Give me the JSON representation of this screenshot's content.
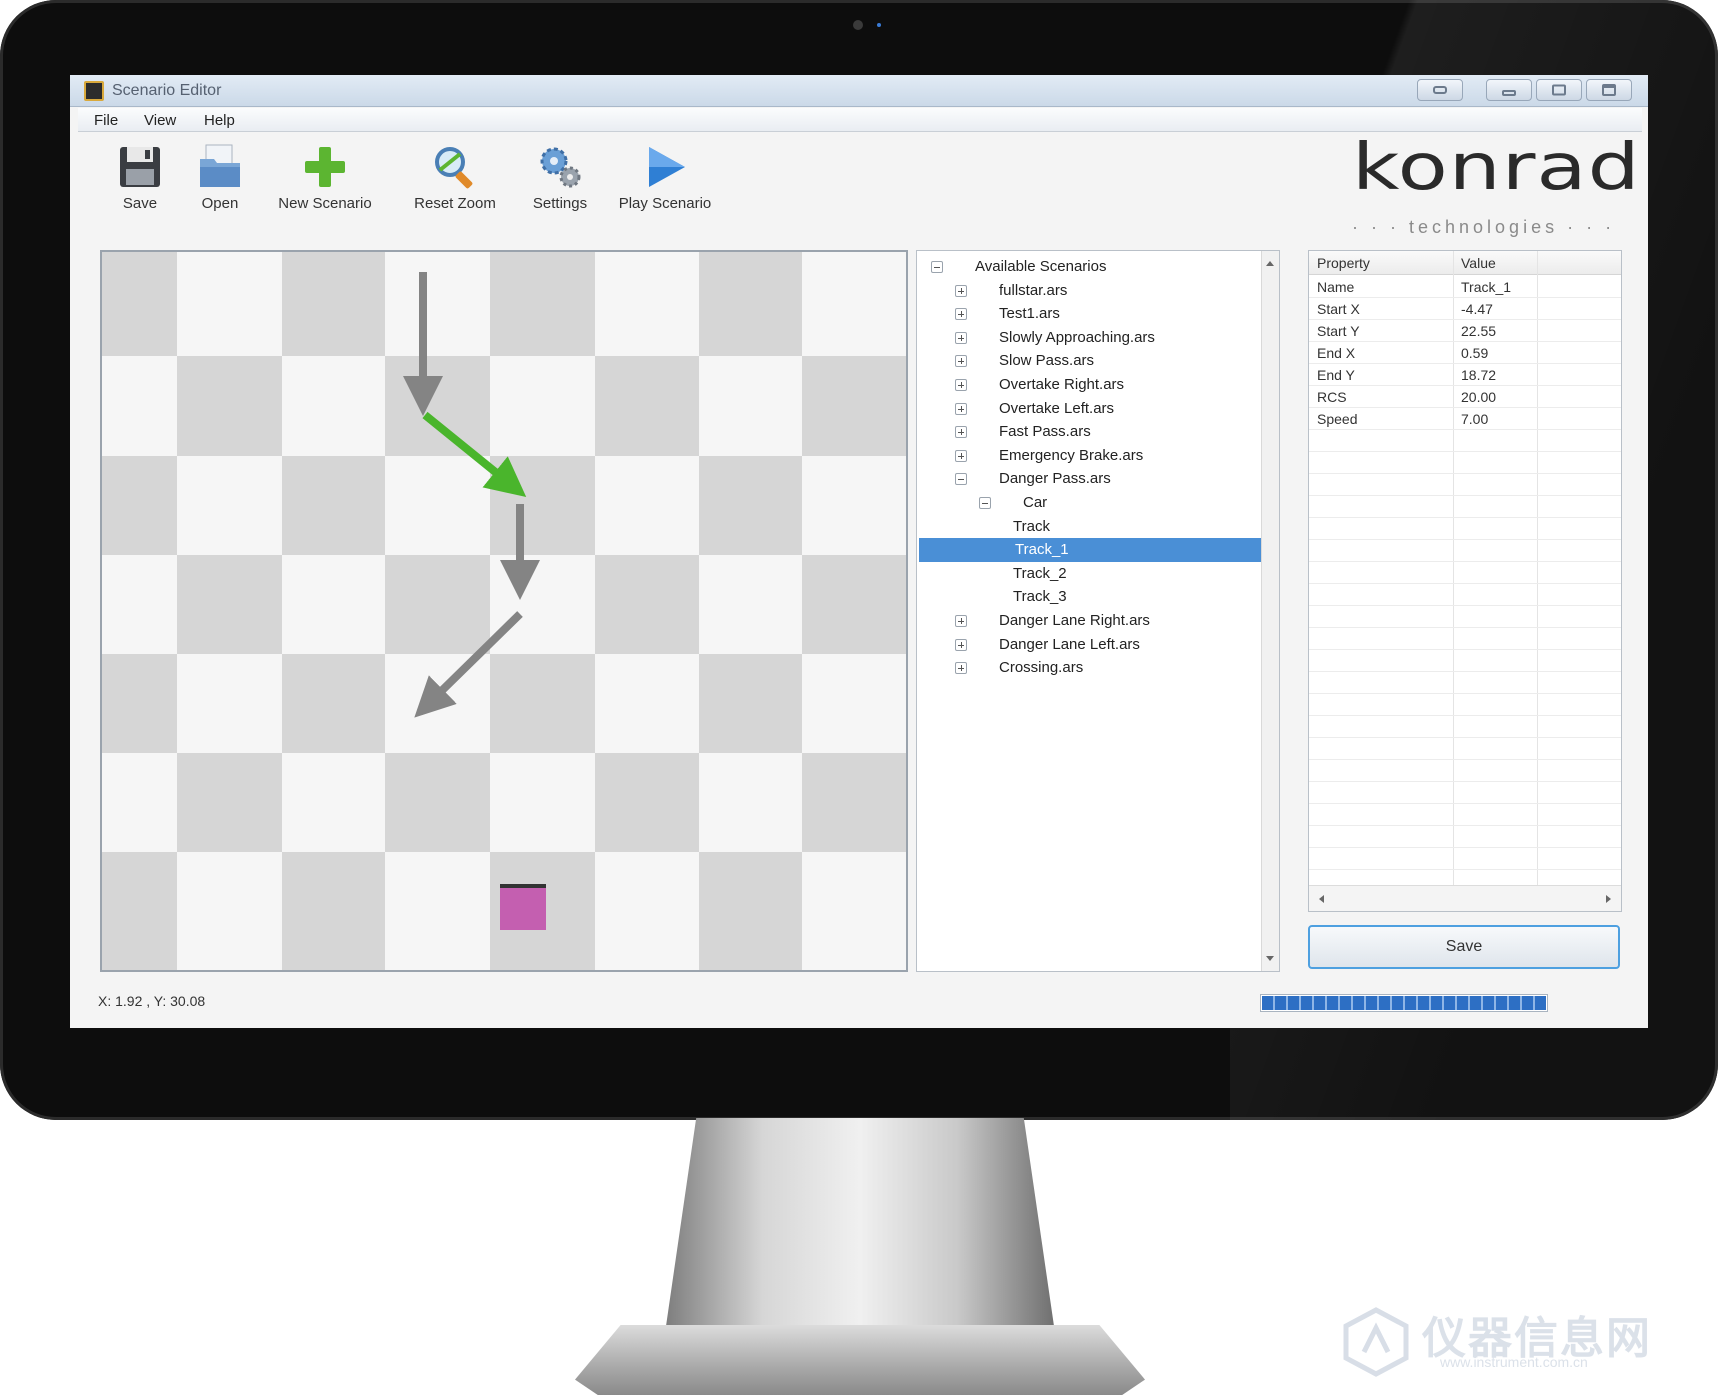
{
  "window": {
    "title": "Scenario Editor"
  },
  "menu": [
    "File",
    "View",
    "Help"
  ],
  "toolbar": [
    {
      "label": "Save",
      "icon": "floppy-disk-icon"
    },
    {
      "label": "Open",
      "icon": "open-folder-icon"
    },
    {
      "label": "New Scenario",
      "icon": "green-plus-icon"
    },
    {
      "label": "Reset Zoom",
      "icon": "magnifier-icon"
    },
    {
      "label": "Settings",
      "icon": "gears-icon"
    },
    {
      "label": "Play Scenario",
      "icon": "play-triangle-icon"
    }
  ],
  "logo": {
    "word": "konrad",
    "tagline": "technologies"
  },
  "canvas": {
    "grid_colors": {
      "light": "#f6f6f6",
      "dark": "#d6d6d6"
    },
    "track_colors": {
      "default": "#848484",
      "selected": "#4ab52c"
    },
    "object_color": "#c45fb0"
  },
  "tree": {
    "root": "Available Scenarios",
    "items": [
      {
        "label": "fullstar.ars"
      },
      {
        "label": "Test1.ars"
      },
      {
        "label": "Slowly Approaching.ars"
      },
      {
        "label": "Slow Pass.ars"
      },
      {
        "label": "Overtake Right.ars"
      },
      {
        "label": "Overtake Left.ars"
      },
      {
        "label": "Fast Pass.ars"
      },
      {
        "label": "Emergency Brake.ars"
      },
      {
        "label": "Danger Pass.ars"
      },
      {
        "label": "Car"
      },
      {
        "label": "Track"
      },
      {
        "label": "Track_1"
      },
      {
        "label": "Track_2"
      },
      {
        "label": "Track_3"
      },
      {
        "label": "Danger Lane Right.ars"
      },
      {
        "label": "Danger Lane Left.ars"
      },
      {
        "label": "Crossing.ars"
      }
    ]
  },
  "properties": {
    "header": {
      "property": "Property",
      "value": "Value"
    },
    "rows": [
      {
        "property": "Name",
        "value": "Track_1"
      },
      {
        "property": "Start X",
        "value": "-4.47"
      },
      {
        "property": "Start Y",
        "value": "22.55"
      },
      {
        "property": "End X",
        "value": "0.59"
      },
      {
        "property": "End Y",
        "value": "18.72"
      },
      {
        "property": "RCS",
        "value": "20.00"
      },
      {
        "property": "Speed",
        "value": "7.00"
      }
    ],
    "save_label": "Save"
  },
  "status": {
    "coords": "X: 1.92 , Y: 30.08",
    "progress": 1.0,
    "accent": "#2d6fc4"
  },
  "watermark": {
    "text": "仪器信息网",
    "url": "www.instrument.com.cn"
  }
}
